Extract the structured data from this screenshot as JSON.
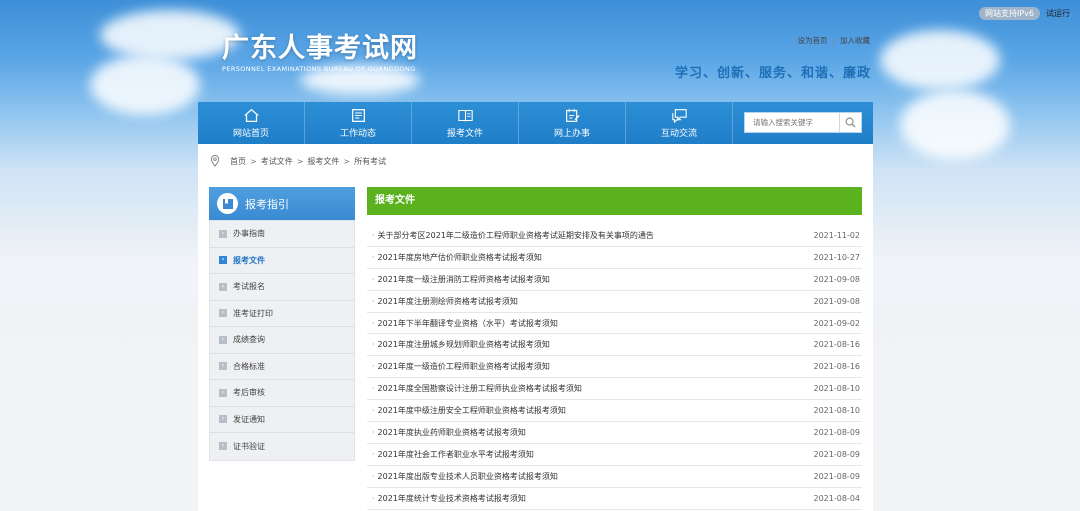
{
  "top_bar": {
    "ipv6_badge": "网站支持IPv6",
    "trial_label": "试运行"
  },
  "header": {
    "logo_cn": "广东人事考试网",
    "logo_en": "PERSONNEL EXAMINATIONS BUREAU OF GUANGDONG",
    "set_homepage": "设为首页",
    "separator": "|",
    "add_favorite": "加入收藏",
    "slogan": "学习、创新、服务、和谐、廉政"
  },
  "nav": {
    "items": [
      {
        "label": "网站首页",
        "icon": "home-icon"
      },
      {
        "label": "工作动态",
        "icon": "news-icon"
      },
      {
        "label": "报考文件",
        "icon": "book-icon"
      },
      {
        "label": "网上办事",
        "icon": "edit-doc-icon"
      },
      {
        "label": "互动交流",
        "icon": "chat-icon"
      }
    ],
    "search_placeholder": "请输入搜索关键字"
  },
  "breadcrumb": {
    "items": [
      "首页",
      "考试文件",
      "报考文件",
      "所有考试"
    ],
    "separator": ">"
  },
  "sidebar": {
    "title": "报考指引",
    "items": [
      {
        "label": "办事指南",
        "active": false
      },
      {
        "label": "报考文件",
        "active": true
      },
      {
        "label": "考试报名",
        "active": false
      },
      {
        "label": "准考证打印",
        "active": false
      },
      {
        "label": "成绩查询",
        "active": false
      },
      {
        "label": "合格标准",
        "active": false
      },
      {
        "label": "考后审核",
        "active": false
      },
      {
        "label": "发证通知",
        "active": false
      },
      {
        "label": "证书验证",
        "active": false
      }
    ]
  },
  "content": {
    "title": "报考文件",
    "rows": [
      {
        "title": "关于部分考区2021年二级造价工程师职业资格考试延期安排及有关事项的通告",
        "date": "2021-11-02"
      },
      {
        "title": "2021年度房地产估价师职业资格考试报考须知",
        "date": "2021-10-27"
      },
      {
        "title": "2021年度一级注册消防工程师资格考试报考须知",
        "date": "2021-09-08"
      },
      {
        "title": "2021年度注册测绘师资格考试报考须知",
        "date": "2021-09-08"
      },
      {
        "title": "2021年下半年翻译专业资格（水平）考试报考须知",
        "date": "2021-09-02"
      },
      {
        "title": "2021年度注册城乡规划师职业资格考试报考须知",
        "date": "2021-08-16"
      },
      {
        "title": "2021年度一级造价工程师职业资格考试报考须知",
        "date": "2021-08-16"
      },
      {
        "title": "2021年度全国勘察设计注册工程师执业资格考试报考须知",
        "date": "2021-08-10"
      },
      {
        "title": "2021年度中级注册安全工程师职业资格考试报考须知",
        "date": "2021-08-10"
      },
      {
        "title": "2021年度执业药师职业资格考试报考须知",
        "date": "2021-08-09"
      },
      {
        "title": "2021年度社会工作者职业水平考试报考须知",
        "date": "2021-08-09"
      },
      {
        "title": "2021年度出版专业技术人员职业资格考试报考须知",
        "date": "2021-08-09"
      },
      {
        "title": "2021年度统计专业技术资格考试报考须知",
        "date": "2021-08-04"
      }
    ]
  },
  "colors": {
    "nav_blue": "#2d8fd6",
    "content_green": "#5cb21e",
    "slogan_blue": "#1e6fb8"
  }
}
